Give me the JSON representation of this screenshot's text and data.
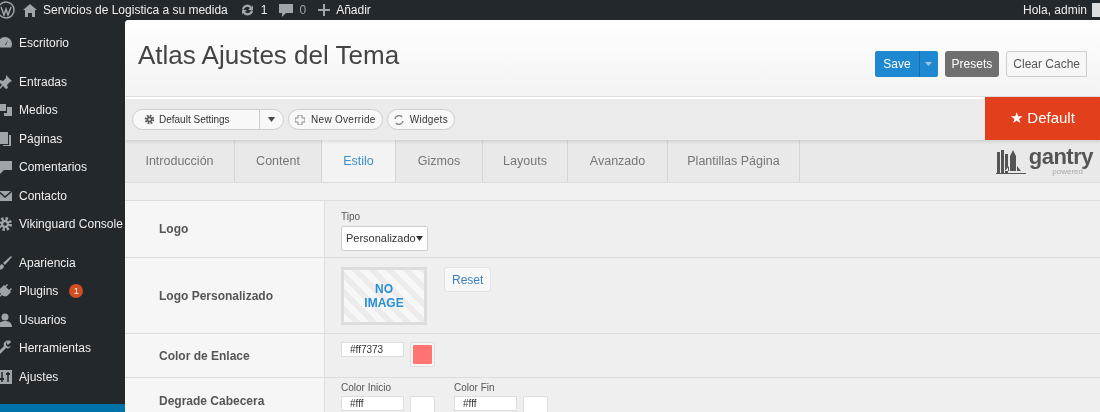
{
  "admin_bar": {
    "site_name": "Servicios de Logistica a su medida",
    "updates": "1",
    "comments": "0",
    "new": "Añadir",
    "greeting": "Hola, admin"
  },
  "sidebar": {
    "items": [
      {
        "label": "Escritorio",
        "selected": false
      },
      {
        "label": "Entradas",
        "selected": false
      },
      {
        "label": "Medios",
        "selected": false
      },
      {
        "label": "Páginas",
        "selected": false
      },
      {
        "label": "Comentarios",
        "selected": false
      },
      {
        "label": "Contacto",
        "selected": false
      },
      {
        "label": "Vikinguard Console",
        "selected": false
      },
      {
        "label": "Apariencia",
        "selected": false
      },
      {
        "label": "Plugins",
        "selected": false,
        "badge": "1"
      },
      {
        "label": "Usuarios",
        "selected": false
      },
      {
        "label": "Herramientas",
        "selected": false
      },
      {
        "label": "Ajustes",
        "selected": false
      },
      {
        "selected": true
      }
    ]
  },
  "header": {
    "title": "Atlas Ajustes del Tema",
    "buttons": [
      "Save",
      "Presets",
      "Clear Cache"
    ]
  },
  "toolbar": {
    "settings_dropdown": "Default Settings",
    "new_override": "New Override",
    "widgets": "Widgets",
    "badge": "★ Default"
  },
  "tabs": [
    {
      "label": "Introducción",
      "selected": false
    },
    {
      "label": "Content",
      "selected": false
    },
    {
      "label": "Estilo",
      "selected": true
    },
    {
      "label": "Gizmos",
      "selected": false
    },
    {
      "label": "Layouts",
      "selected": false
    },
    {
      "label": "Avanzado",
      "selected": false
    },
    {
      "label": "Plantillas Página",
      "selected": false
    }
  ],
  "brand": {
    "name": "gantry",
    "tagline": "powered"
  },
  "settings": [
    {
      "kind": "select",
      "label": "Logo",
      "caption": "Tipo",
      "value": "Personalizado"
    },
    {
      "kind": "image",
      "label": "Logo Personalizado",
      "placeholder_text": "NO IMAGE",
      "button": "Reset"
    },
    {
      "kind": "color",
      "label": "Color de Enlace",
      "value": "#ff7373",
      "color": "#ff7373"
    },
    {
      "kind": "gradient",
      "label": "Degrade Cabecera",
      "fields": [
        {
          "caption": "Color Inicio",
          "value": "#fff",
          "color": "#ffffff"
        },
        {
          "caption": "Color Fin",
          "value": "#fff",
          "color": "#ffffff"
        }
      ]
    }
  ]
}
